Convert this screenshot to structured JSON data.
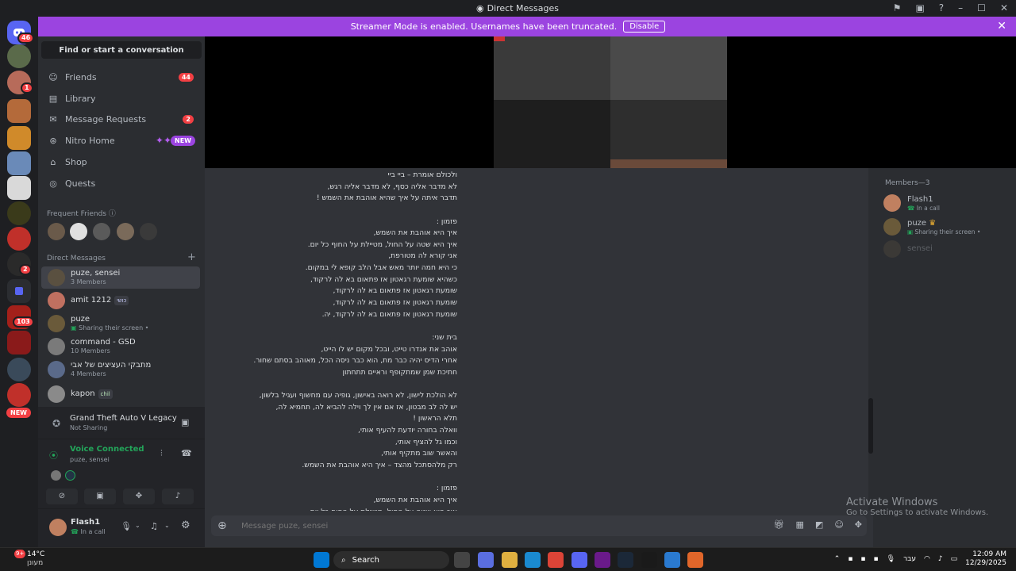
{
  "window": {
    "title": "Direct Messages"
  },
  "banner": {
    "text": "Streamer Mode is enabled. Usernames have been truncated.",
    "button": "Disable"
  },
  "rail": {
    "home_badge": "46",
    "server_badges": [
      "1",
      "2",
      "103"
    ],
    "new_label": "NEW"
  },
  "sidebar": {
    "search": "Find or start a conversation",
    "nav": [
      {
        "label": "Friends",
        "icon": "friends-icon",
        "count": "44"
      },
      {
        "label": "Library",
        "icon": "library-icon"
      },
      {
        "label": "Message Requests",
        "icon": "mail-icon",
        "count": "2"
      },
      {
        "label": "Nitro Home",
        "icon": "nitro-icon",
        "badge": "NEW"
      },
      {
        "label": "Shop",
        "icon": "shop-icon"
      },
      {
        "label": "Quests",
        "icon": "quests-icon"
      }
    ],
    "frequent_friends_label": "Frequent Friends",
    "direct_messages_label": "Direct Messages",
    "dms": [
      {
        "name": "puze, sensei",
        "sub": "3 Members"
      },
      {
        "name": "amit 1212",
        "sub": "",
        "tag": "כושי"
      },
      {
        "name": "puze",
        "sub": "Sharing their screen • "
      },
      {
        "name": "command - GSD",
        "sub": "10 Members"
      },
      {
        "name": "מתבקי העציצים של אבי",
        "sub": "4 Members"
      },
      {
        "name": "kapon",
        "sub": "",
        "tag": "chil"
      }
    ]
  },
  "activity": {
    "game": "Grand Theft Auto V Legacy",
    "status": "Not Sharing"
  },
  "voice": {
    "title": "Voice Connected",
    "channel": "puze, sensei"
  },
  "user": {
    "name": "Flash1",
    "status": "In a call"
  },
  "chat": {
    "lines": [
      "ולכולם אומרת – ביי ביי",
      "לא מדבר אליה כסף, לא מדבר אליה רגש,",
      "תדבר איתה על איך שהיא אוהבת את השמש !",
      "",
      "פזמון :",
      "איך היא אוהבת את השמש,",
      "איך היא שטה על החול, מטיילת על החוף כל יום.",
      "אני קורא לה מטורפת,",
      "כי היא חמה יותר מאש אבל הלב קופא לי במקום.",
      "כשהיא שומעת רגאטון אז פתאום בא לה לרקוד,",
      "שומעת רגאטון אז פתאום בא לה לרקוד,",
      "שומעת רגאטון אז פתאום בא לה לרקוד,",
      "שומעת רגאטון אז פתאום בא לה לרקוד, יה.",
      "",
      "בית שני:",
      "אוהב את אנדרו טייט, ובכל מקום יש לו הייט,",
      "אחרי הדיס יהיה כבר מת, הוא כבר ניסה הכל, מאוהב בסתם שחור.",
      "חתיכת שמן שמתקופף וראיים תתחתון",
      "",
      "לא הולכת לישון, לא רואה באישון, גופיה עם מחשוף ועגיל בלשון,",
      "יש לה לב מבטון, אז אם אין לך וילה להביא לה, תחמיא לה,",
      "תלא הראשון !",
      "וואלה בחורה יודעת להעיף אותי,",
      "וכמו גל להציף אותי,",
      "והאשר שוב מתקיף אותי,",
      "רק מלהסתכל מהצד – איך היא אוהבת את השמש.",
      "",
      "פזמון :",
      "איך היא אוהבת את השמש,",
      "איך היא שטה על החול, מטיילת על החוף כל יום."
    ]
  },
  "composer": {
    "placeholder": "Message puze, sensei"
  },
  "members": {
    "header": "Members—3",
    "list": [
      {
        "name": "Flash1",
        "sub": "In a call"
      },
      {
        "name": "puze",
        "sub": "Sharing their screen • "
      },
      {
        "name": "sensei",
        "sub": ""
      }
    ]
  },
  "watermark": {
    "title": "Activate Windows",
    "sub": "Go to Settings to activate Windows."
  },
  "taskbar": {
    "temp": "14°C",
    "weather": "מעונן",
    "search": "Search",
    "lang": "עבר",
    "time": "12:09 AM",
    "date": "12/29/2025",
    "notif": "9+"
  },
  "colors": {
    "accent": "#9b44e0",
    "danger": "#f23f43",
    "online": "#23a55a",
    "bg": "#313338"
  }
}
